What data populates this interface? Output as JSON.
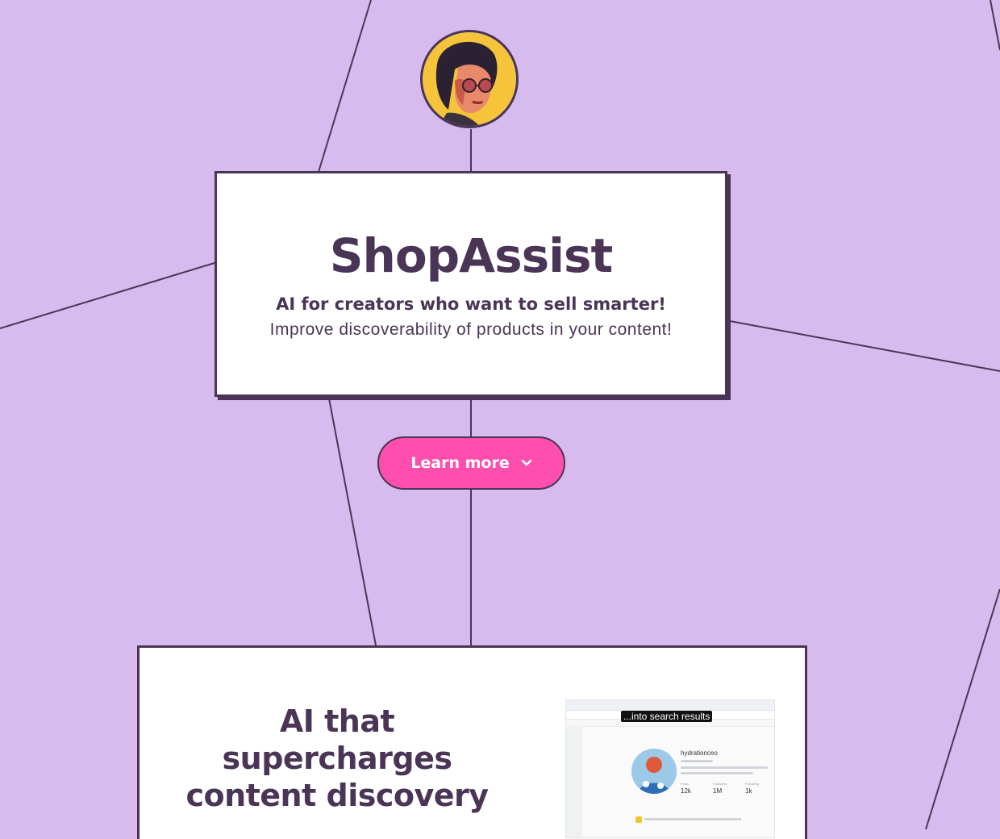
{
  "hero": {
    "title": "ShopAssist",
    "subtitle": "AI for creators who want to sell smarter!",
    "description": "Improve discoverability of products in your content!"
  },
  "cta": {
    "label": "Learn more",
    "icon": "chevron-down-icon"
  },
  "feature": {
    "title_lines": [
      "AI that",
      "supercharges",
      "content discovery"
    ],
    "screenshot": {
      "caption": "...into search results",
      "username": "hydrationceo",
      "stats": [
        {
          "label": "Posts",
          "value": "12k"
        },
        {
          "label": "Followers",
          "value": "1M"
        },
        {
          "label": "Following",
          "value": "1k"
        }
      ]
    }
  },
  "colors": {
    "background": "#d8bbee",
    "ink": "#4a3556",
    "accent": "#ff4fae",
    "card": "#ffffff"
  }
}
